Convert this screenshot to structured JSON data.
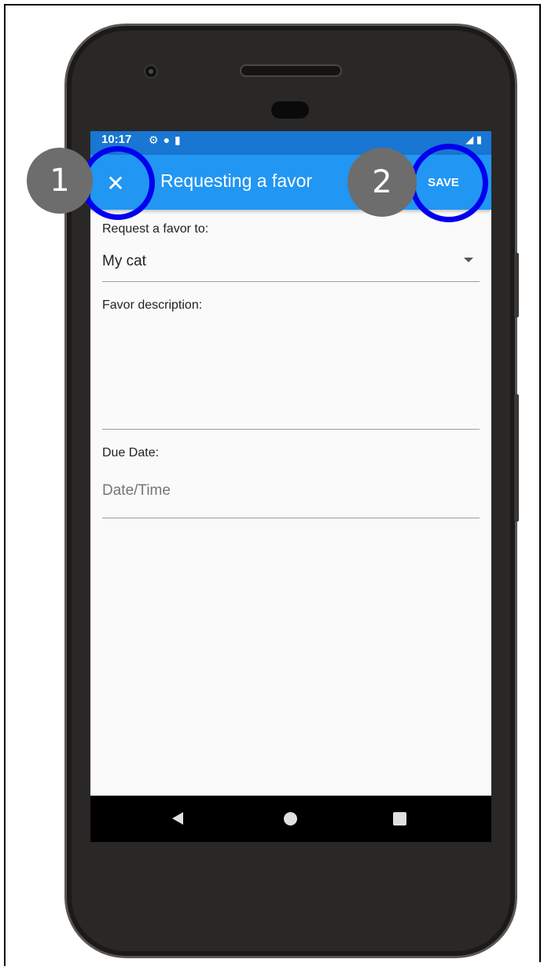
{
  "status_bar": {
    "time": "10:17",
    "icons": [
      "gear-icon",
      "alert-icon",
      "sd-card-icon"
    ],
    "right_icons": [
      "signal-icon",
      "battery-icon"
    ],
    "bar_color": "#1976d2"
  },
  "app_bar": {
    "title": "Requesting a favor",
    "close_glyph": "✕",
    "save_label": "SAVE",
    "color": "#2196f3"
  },
  "form": {
    "request_label": "Request a favor to:",
    "request_value": "My cat",
    "description_label": "Favor description:",
    "due_label": "Due Date:",
    "due_placeholder": "Date/Time"
  },
  "annotations": [
    {
      "number": "1",
      "target": "close-button"
    },
    {
      "number": "2",
      "target": "save-button"
    }
  ],
  "annotation_colors": {
    "ring": "#0000ee",
    "badge": "#6d6d6d"
  }
}
